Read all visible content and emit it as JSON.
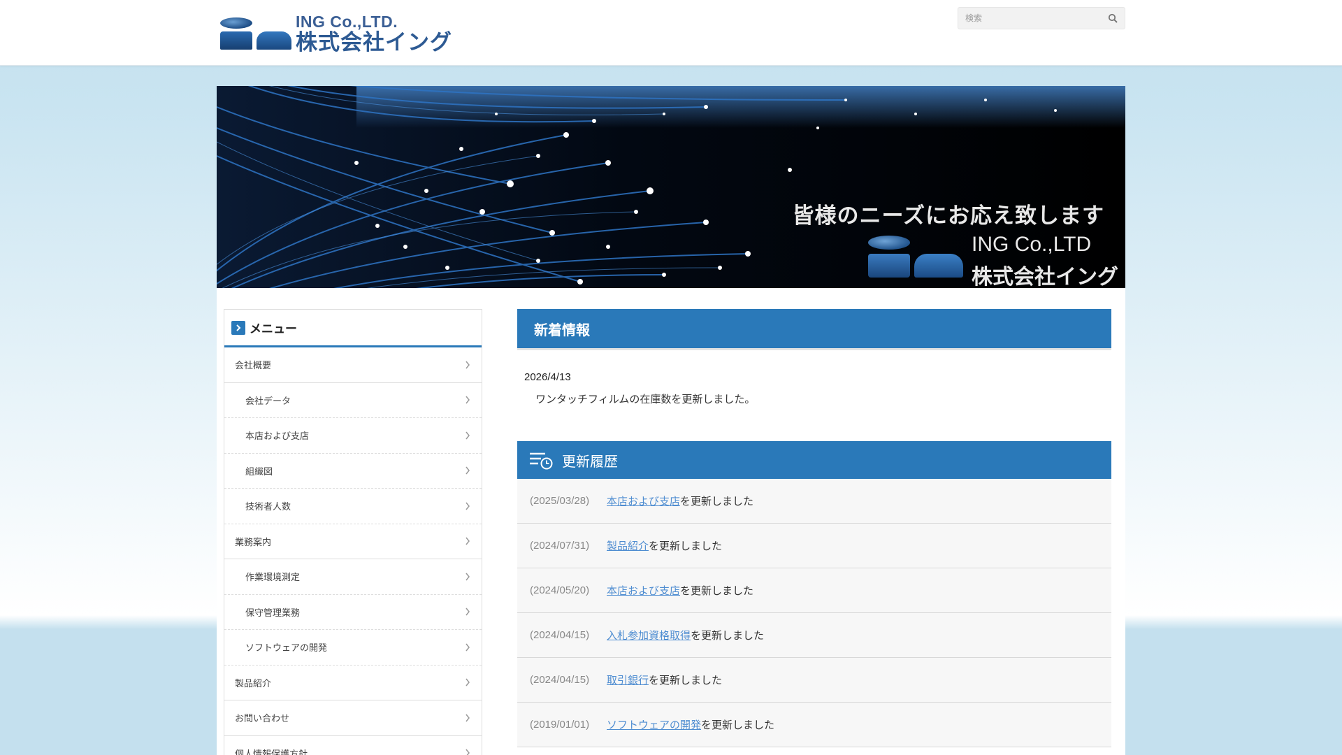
{
  "header": {
    "logo_en": "ING Co.,LTD.",
    "logo_jp": "株式会社イング",
    "search_placeholder": "検索"
  },
  "hero": {
    "tagline": "皆様のニーズにお応え致します",
    "company_en": "ING Co.,LTD",
    "company_jp": "株式会社イング"
  },
  "sidebar": {
    "title": "メニュー",
    "items": [
      {
        "label": "会社概要",
        "level": 1
      },
      {
        "label": "会社データ",
        "level": 2
      },
      {
        "label": "本店および支店",
        "level": 2
      },
      {
        "label": "組織図",
        "level": 2
      },
      {
        "label": "技術者人数",
        "level": 2
      },
      {
        "label": "業務案内",
        "level": 1
      },
      {
        "label": "作業環境測定",
        "level": 2
      },
      {
        "label": "保守管理業務",
        "level": 2
      },
      {
        "label": "ソフトウェアの開発",
        "level": 2
      },
      {
        "label": "製品紹介",
        "level": 1
      },
      {
        "label": "お問い合わせ",
        "level": 1
      },
      {
        "label": "個人情報保護方針",
        "level": 1
      }
    ]
  },
  "news": {
    "title": "新着情報",
    "date": "2026/4/13",
    "text": "ワンタッチフィルムの在庫数を更新しました。"
  },
  "history": {
    "title": "更新履歴",
    "rows": [
      {
        "date": "(2025/03/28)",
        "link": "本店および支店",
        "suffix": "を更新しました"
      },
      {
        "date": "(2024/07/31)",
        "link": "製品紹介",
        "suffix": "を更新しました"
      },
      {
        "date": "(2024/05/20)",
        "link": "本店および支店",
        "suffix": "を更新しました"
      },
      {
        "date": "(2024/04/15)",
        "link": "入札参加資格取得",
        "suffix": "を更新しました"
      },
      {
        "date": "(2024/04/15)",
        "link": "取引銀行",
        "suffix": "を更新しました"
      },
      {
        "date": "(2019/01/01)",
        "link": "ソフトウェアの開発",
        "suffix": "を更新しました"
      }
    ]
  },
  "colors": {
    "accent": "#2a79b9",
    "link": "#4f8dd1"
  }
}
